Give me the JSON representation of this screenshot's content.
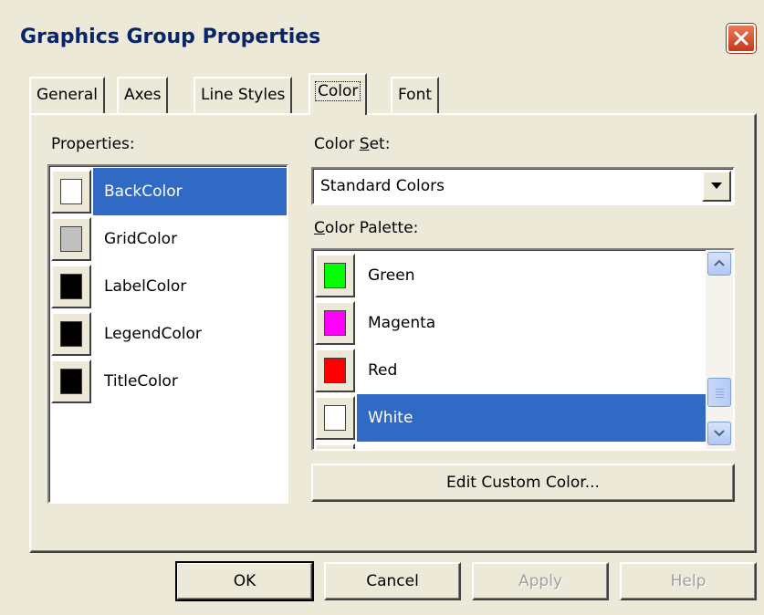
{
  "window": {
    "title": "Graphics Group Properties"
  },
  "tabs": [
    {
      "label": "General"
    },
    {
      "label": "Axes"
    },
    {
      "label": "Line Styles"
    },
    {
      "label": "Color"
    },
    {
      "label": "Font"
    }
  ],
  "active_tab": "Color",
  "properties": {
    "label": "Properties:",
    "items": [
      {
        "label": "BackColor",
        "color": "#ffffff"
      },
      {
        "label": "GridColor",
        "color": "#c0c0c0"
      },
      {
        "label": "LabelColor",
        "color": "#000000"
      },
      {
        "label": "LegendColor",
        "color": "#000000"
      },
      {
        "label": "TitleColor",
        "color": "#000000"
      }
    ],
    "selected": "BackColor"
  },
  "color_set": {
    "label": "Color Set:",
    "value": "Standard Colors"
  },
  "color_palette": {
    "label": "Color Palette:",
    "items": [
      {
        "label": "Green",
        "color": "#00ff00"
      },
      {
        "label": "Magenta",
        "color": "#ff00ff"
      },
      {
        "label": "Red",
        "color": "#ff0000"
      },
      {
        "label": "White",
        "color": "#ffffff"
      }
    ],
    "selected": "White"
  },
  "buttons": {
    "edit_custom_color": "Edit Custom Color...",
    "ok": "OK",
    "cancel": "Cancel",
    "apply": "Apply",
    "help": "Help"
  },
  "colors": {
    "selection": "#316ac5",
    "title_text": "#0a246a",
    "dialog_bg": "#ece9d8"
  }
}
